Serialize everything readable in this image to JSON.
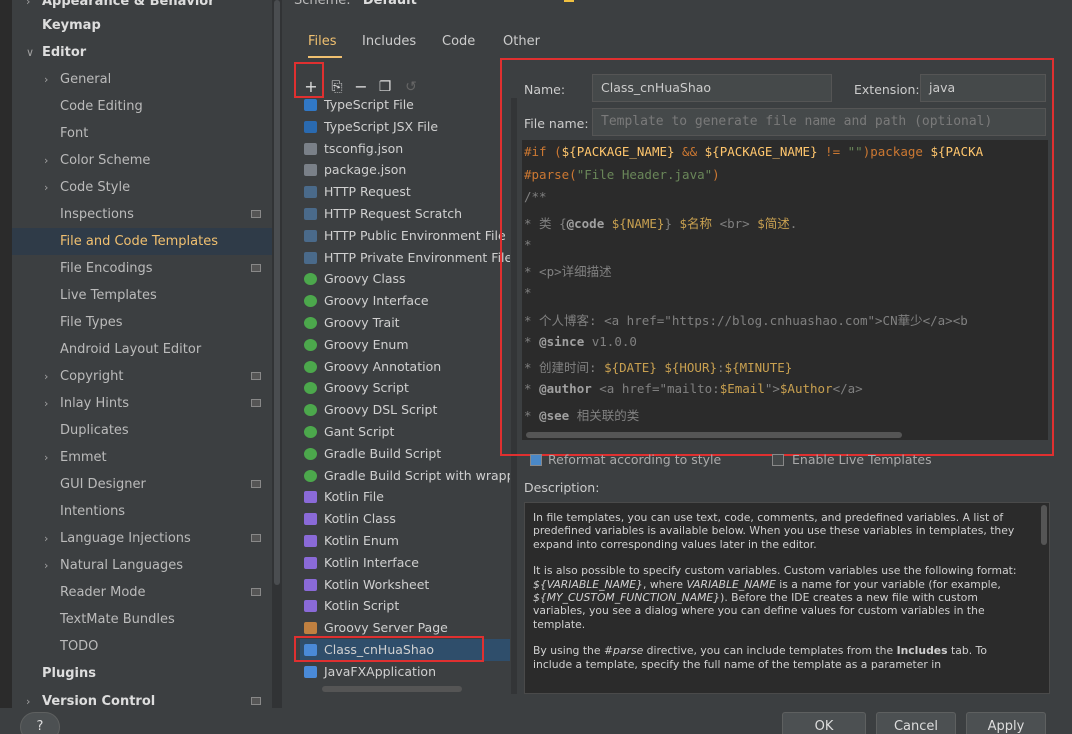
{
  "sidebar": {
    "items": [
      {
        "label": "Appearance & Behavior",
        "arrow": ">",
        "bold": true
      },
      {
        "label": "Keymap",
        "bold": true
      },
      {
        "label": "Editor",
        "arrow": "v",
        "bold": true
      },
      {
        "label": "General",
        "arrow": ">"
      },
      {
        "label": "Code Editing"
      },
      {
        "label": "Font"
      },
      {
        "label": "Color Scheme",
        "arrow": ">"
      },
      {
        "label": "Code Style",
        "arrow": ">"
      },
      {
        "label": "Inspections",
        "badge": true
      },
      {
        "label": "File and Code Templates",
        "selected": true
      },
      {
        "label": "File Encodings",
        "badge": true
      },
      {
        "label": "Live Templates"
      },
      {
        "label": "File Types"
      },
      {
        "label": "Android Layout Editor"
      },
      {
        "label": "Copyright",
        "arrow": ">",
        "badge": true
      },
      {
        "label": "Inlay Hints",
        "arrow": ">",
        "badge": true
      },
      {
        "label": "Duplicates"
      },
      {
        "label": "Emmet",
        "arrow": ">"
      },
      {
        "label": "GUI Designer",
        "badge": true
      },
      {
        "label": "Intentions"
      },
      {
        "label": "Language Injections",
        "arrow": ">",
        "badge": true
      },
      {
        "label": "Natural Languages",
        "arrow": ">"
      },
      {
        "label": "Reader Mode",
        "badge": true
      },
      {
        "label": "TextMate Bundles"
      },
      {
        "label": "TODO"
      },
      {
        "label": "Plugins",
        "bold": true
      },
      {
        "label": "Version Control",
        "arrow": ">",
        "bold": true,
        "badge": true
      }
    ]
  },
  "scheme": {
    "label": "Scheme:",
    "value": "Default"
  },
  "tabs": [
    {
      "label": "Files",
      "active": true
    },
    {
      "label": "Includes"
    },
    {
      "label": "Code"
    },
    {
      "label": "Other"
    }
  ],
  "toolbar": {
    "add": "+",
    "copy": "⎘",
    "remove": "−",
    "duplicate": "❐",
    "reset": "↺"
  },
  "templates": [
    {
      "label": "TypeScript File",
      "icon": "ts"
    },
    {
      "label": "TypeScript JSX File",
      "icon": "tsx"
    },
    {
      "label": "tsconfig.json",
      "icon": "json"
    },
    {
      "label": "package.json",
      "icon": "json"
    },
    {
      "label": "HTTP Request",
      "icon": "http"
    },
    {
      "label": "HTTP Request Scratch",
      "icon": "http"
    },
    {
      "label": "HTTP Public Environment File",
      "icon": "http"
    },
    {
      "label": "HTTP Private Environment File",
      "icon": "http"
    },
    {
      "label": "Groovy Class",
      "icon": "groovy"
    },
    {
      "label": "Groovy Interface",
      "icon": "groovy"
    },
    {
      "label": "Groovy Trait",
      "icon": "groovy"
    },
    {
      "label": "Groovy Enum",
      "icon": "groovy"
    },
    {
      "label": "Groovy Annotation",
      "icon": "groovy"
    },
    {
      "label": "Groovy Script",
      "icon": "groovy"
    },
    {
      "label": "Groovy DSL Script",
      "icon": "groovy"
    },
    {
      "label": "Gant Script",
      "icon": "groovy"
    },
    {
      "label": "Gradle Build Script",
      "icon": "groovy"
    },
    {
      "label": "Gradle Build Script with wrapper",
      "icon": "groovy"
    },
    {
      "label": "Kotlin File",
      "icon": "kotlin"
    },
    {
      "label": "Kotlin Class",
      "icon": "kotlin"
    },
    {
      "label": "Kotlin Enum",
      "icon": "kotlin"
    },
    {
      "label": "Kotlin Interface",
      "icon": "kotlin"
    },
    {
      "label": "Kotlin Worksheet",
      "icon": "kotlin"
    },
    {
      "label": "Kotlin Script",
      "icon": "kotlin"
    },
    {
      "label": "Groovy Server Page",
      "icon": "jsp"
    },
    {
      "label": "Class_cnHuaShao",
      "icon": "java",
      "selected": true
    },
    {
      "label": "JavaFXApplication",
      "icon": "java"
    }
  ],
  "editor": {
    "name_label": "Name:",
    "name_value": "Class_cnHuaShao",
    "extension_label": "Extension:",
    "extension_value": "java",
    "filename_label": "File name:",
    "filename_placeholder": "Template to generate file name and path (optional)",
    "code": {
      "l1_a": "#if (",
      "l1_b": "${PACKAGE_NAME}",
      "l1_c": " && ",
      "l1_d": "${PACKAGE_NAME}",
      "l1_e": " != ",
      "l1_f": "\"\"",
      "l1_g": ")package ",
      "l1_h": "${PACKA",
      "l2_a": "#parse(",
      "l2_b": "\"File Header.java\"",
      "l2_c": ")",
      "l3": "/**",
      "l4_a": " * 类 {",
      "l4_b": "@code",
      "l4_c": " ",
      "l4_d": "${NAME}",
      "l4_e": "} ",
      "l4_f": "$名称",
      "l4_g": " <br> ",
      "l4_h": "$简述",
      "l4_i": ".",
      "l5": " *",
      "l6": " * <p>详细描述",
      "l7": " *",
      "l8": " * 个人博客: <a href=\"https://blog.cnhuashao.com\">CN華少</a><b",
      "l9_a": " * ",
      "l9_b": "@since",
      "l9_c": " v1.0.0",
      "l10_a": " * 创建时间: ",
      "l10_b": "${DATE}",
      "l10_c": " ",
      "l10_d": "${HOUR}",
      "l10_e": ":",
      "l10_f": "${MINUTE}",
      "l11_a": " * ",
      "l11_b": "@author",
      "l11_c": " <a href=\"mailto:",
      "l11_d": "$Email",
      "l11_e": "\">",
      "l11_f": "$Author",
      "l11_g": "</a>",
      "l12_a": " * ",
      "l12_b": "@see",
      "l12_c": " 相关联的类"
    }
  },
  "options": {
    "reformat": "Reformat according to style",
    "live_templates": "Enable Live Templates"
  },
  "description": {
    "label": "Description:",
    "p1": "In file templates, you can use text, code, comments, and predefined variables. A list of predefined variables is available below. When you use these variables in templates, they expand into corresponding values later in the editor.",
    "p2_a": "It is also possible to specify custom variables. Custom variables use the following format: ",
    "p2_b": "${VARIABLE_NAME}",
    "p2_c": ", where ",
    "p2_d": "VARIABLE_NAME",
    "p2_e": " is a name for your variable (for example, ",
    "p2_f": "${MY_CUSTOM_FUNCTION_NAME}",
    "p2_g": "). Before the IDE creates a new file with custom variables, you see a dialog where you can define values for custom variables in the template.",
    "p3_a": "By using the ",
    "p3_b": "#parse",
    "p3_c": " directive, you can include templates from the ",
    "p3_d": "Includes",
    "p3_e": " tab. To include a template, specify the full name of the template as a parameter in"
  },
  "buttons": {
    "ok": "OK",
    "cancel": "Cancel",
    "apply": "Apply",
    "help": "?"
  }
}
